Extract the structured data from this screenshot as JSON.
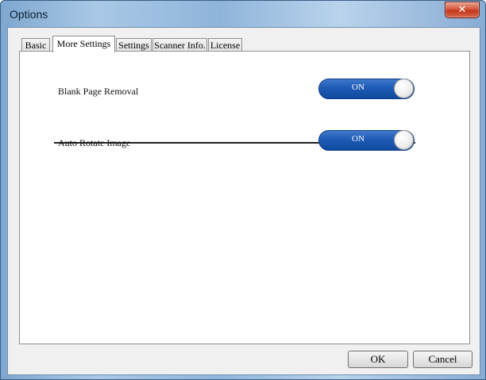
{
  "window": {
    "title": "Options",
    "close_glyph": "✕"
  },
  "tabs": [
    {
      "label": "Basic",
      "active": false
    },
    {
      "label": "More Settings",
      "active": true
    },
    {
      "label": "Settings",
      "active": false
    },
    {
      "label": "Scanner Info.",
      "active": false
    },
    {
      "label": "License",
      "active": false
    }
  ],
  "settings": [
    {
      "label": "Blank Page Removal",
      "toggle": "ON"
    },
    {
      "label": "Auto Rotate Image",
      "toggle": "ON"
    }
  ],
  "buttons": {
    "ok": "OK",
    "cancel": "Cancel"
  },
  "colors": {
    "toggle_on": "#1e5bb5",
    "close_button": "#c23418"
  }
}
